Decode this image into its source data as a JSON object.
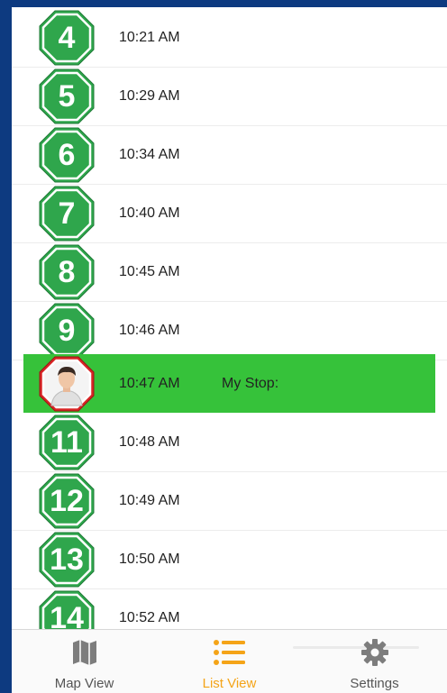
{
  "stops": [
    {
      "number": "4",
      "time": "10:21 AM",
      "color": "#2fa64c"
    },
    {
      "number": "5",
      "time": "10:29 AM",
      "color": "#2fa64c"
    },
    {
      "number": "6",
      "time": "10:34 AM",
      "color": "#2fa64c"
    },
    {
      "number": "7",
      "time": "10:40 AM",
      "color": "#2fa64c"
    },
    {
      "number": "8",
      "time": "10:45 AM",
      "color": "#2fa64c"
    },
    {
      "number": "9",
      "time": "10:46 AM",
      "color": "#2fa64c"
    },
    {
      "number": "",
      "time": "10:47 AM",
      "label": "My Stop:",
      "color": "#d92626",
      "icon": "person-avatar-icon",
      "highlight": "#36c23a"
    },
    {
      "number": "11",
      "time": "10:48 AM",
      "color": "#2fa64c"
    },
    {
      "number": "12",
      "time": "10:49 AM",
      "color": "#2fa64c"
    },
    {
      "number": "13",
      "time": "10:50 AM",
      "color": "#2fa64c"
    },
    {
      "number": "14",
      "time": "10:52 AM",
      "color": "#2fa64c"
    }
  ],
  "tabs": {
    "map": {
      "label": "Map View",
      "icon": "map-icon"
    },
    "list": {
      "label": "List View",
      "icon": "list-icon",
      "active_color": "#f4a418"
    },
    "settings": {
      "label": "Settings",
      "icon": "gear-icon"
    }
  }
}
